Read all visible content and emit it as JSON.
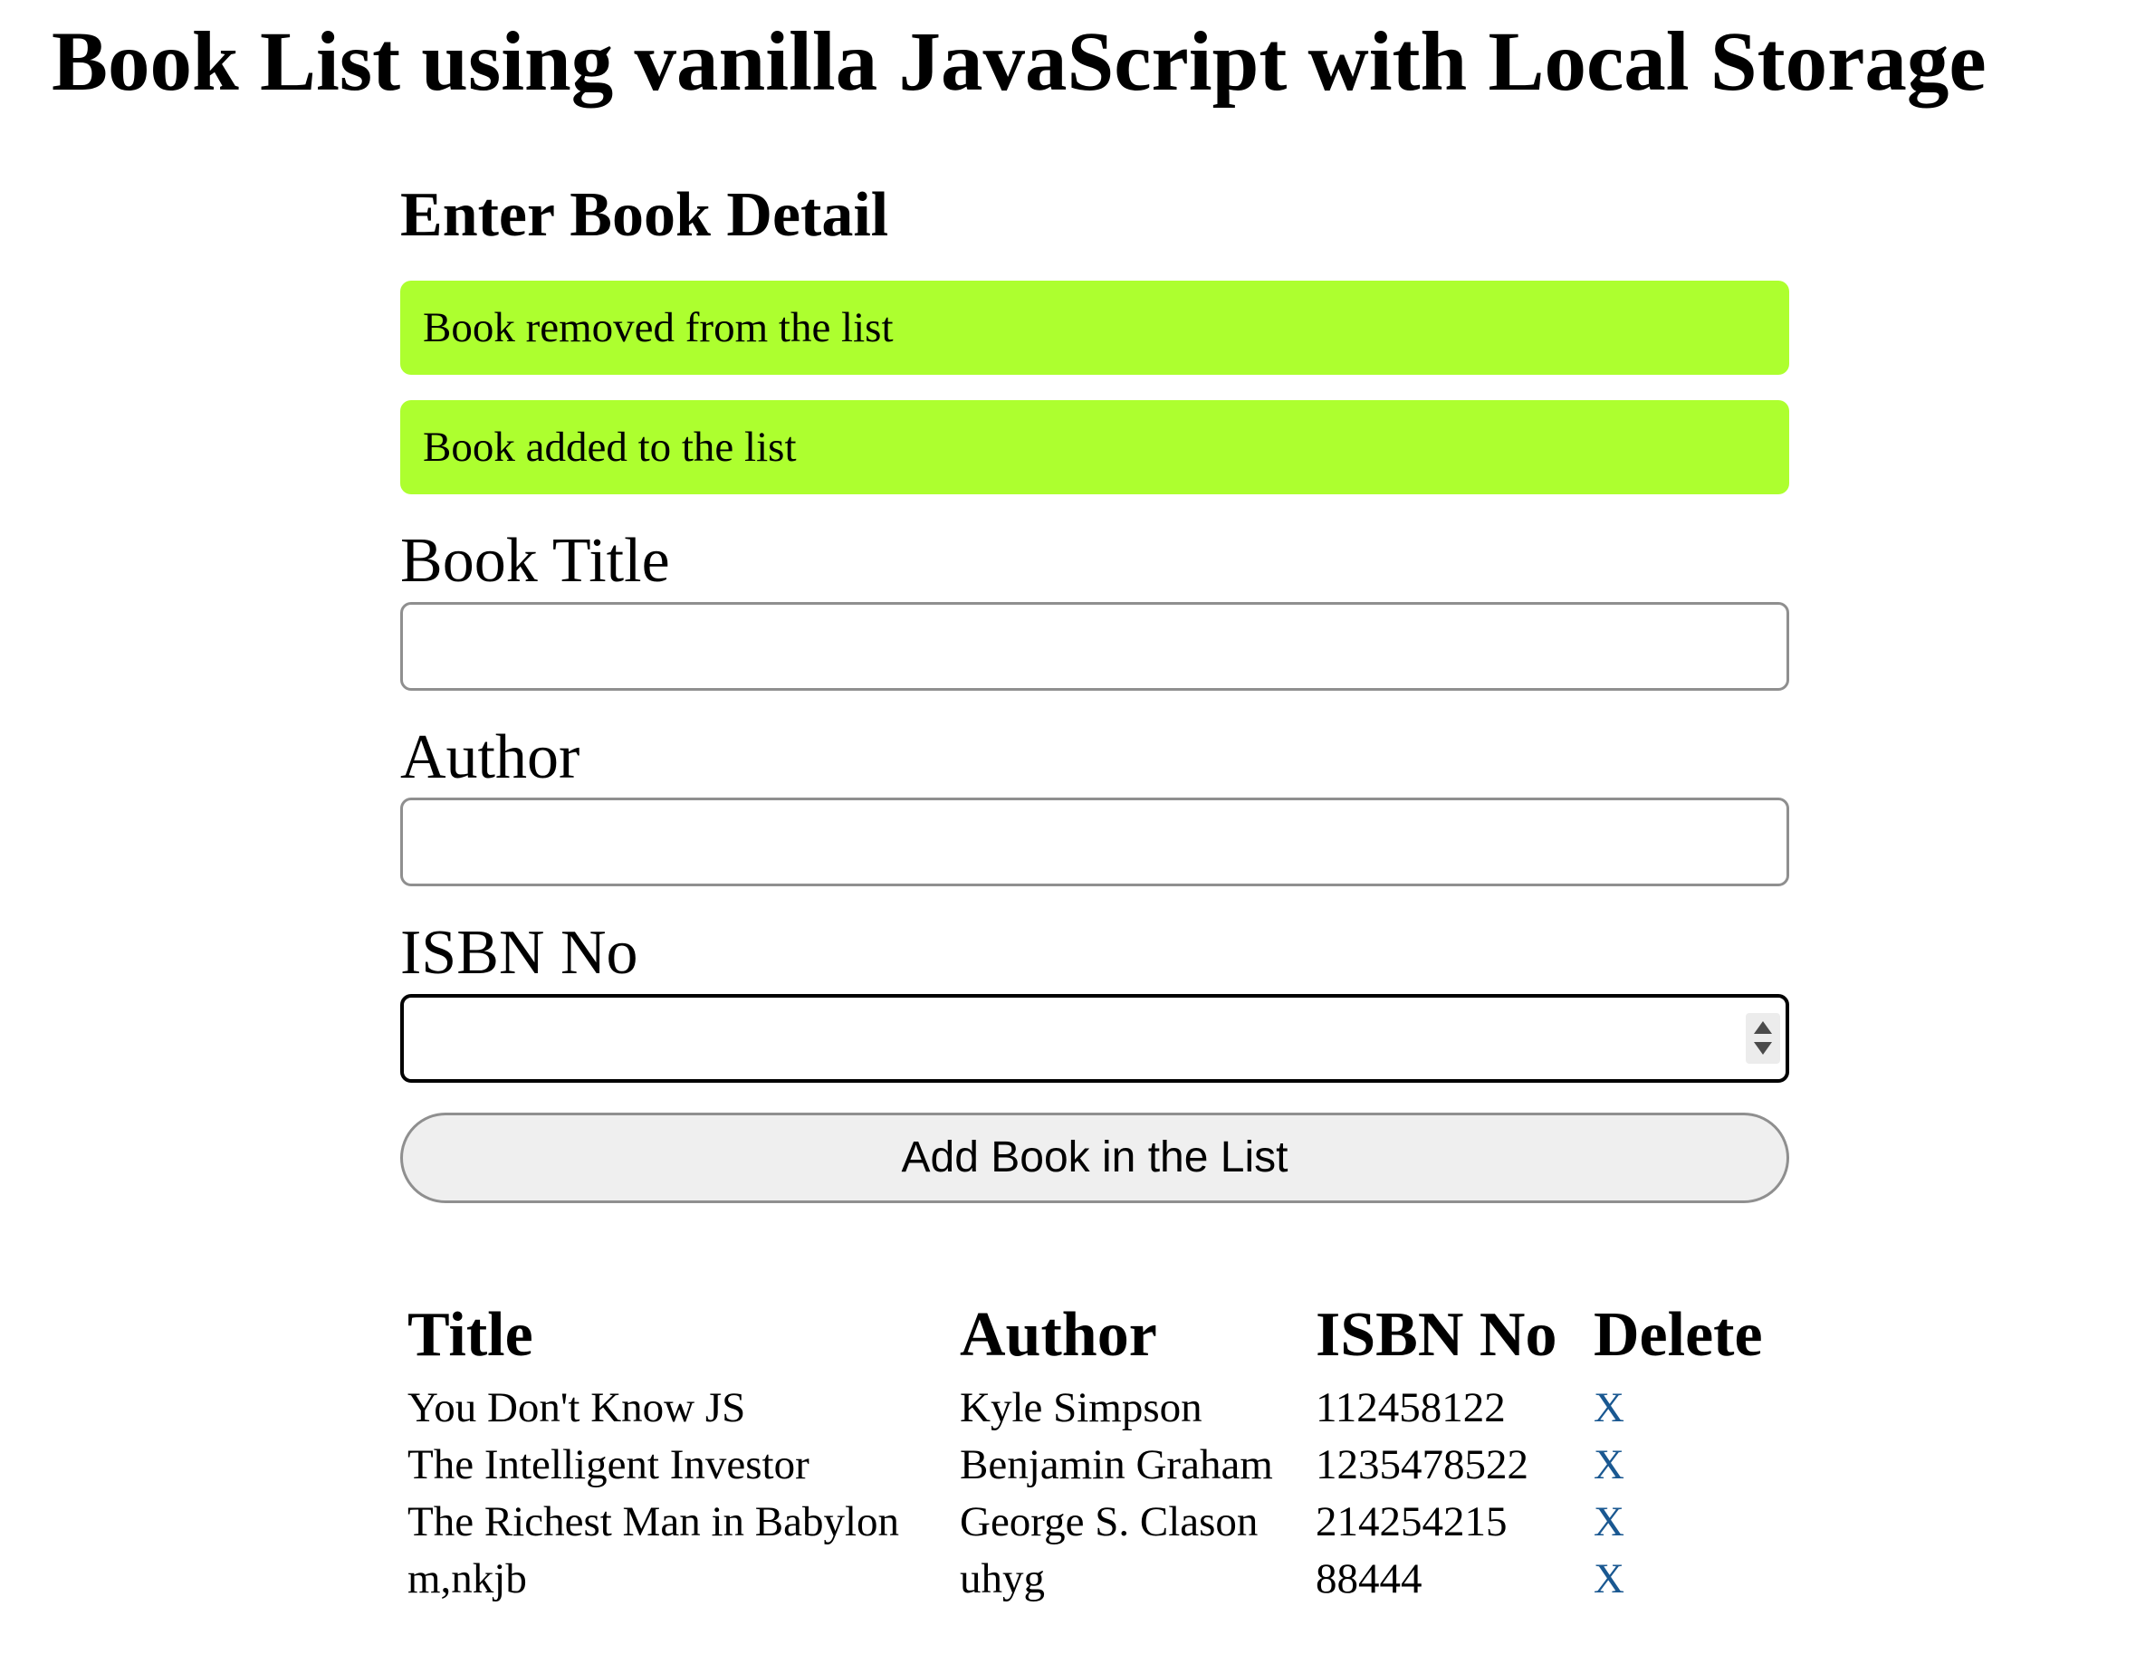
{
  "header": {
    "title": "Book List using vanilla JavaScript with Local Storage"
  },
  "form": {
    "section_title": "Enter Book Detail",
    "alerts": [
      "Book removed from the list",
      "Book added to the list"
    ],
    "fields": {
      "title_label": "Book Title",
      "title_value": "",
      "author_label": "Author",
      "author_value": "",
      "isbn_label": "ISBN No",
      "isbn_value": ""
    },
    "submit_label": "Add Book in the List"
  },
  "table": {
    "headers": [
      "Title",
      "Author",
      "ISBN No",
      "Delete"
    ],
    "rows": [
      {
        "title": "You Don't Know JS",
        "author": "Kyle Simpson",
        "isbn": "112458122",
        "delete": "X"
      },
      {
        "title": "The Intelligent Investor",
        "author": "Benjamin Graham",
        "isbn": "1235478522",
        "delete": "X"
      },
      {
        "title": "The Richest Man in Babylon",
        "author": "George S. Clason",
        "isbn": "214254215",
        "delete": "X"
      },
      {
        "title": "m,nkjb",
        "author": "uhyg",
        "isbn": "88444",
        "delete": "X"
      }
    ]
  },
  "colors": {
    "alert_background": "#adff2f",
    "delete_link": "#1a5891",
    "button_background": "#efefef"
  },
  "icons": {
    "isbn_spinner": "spinner-arrows-icon"
  }
}
